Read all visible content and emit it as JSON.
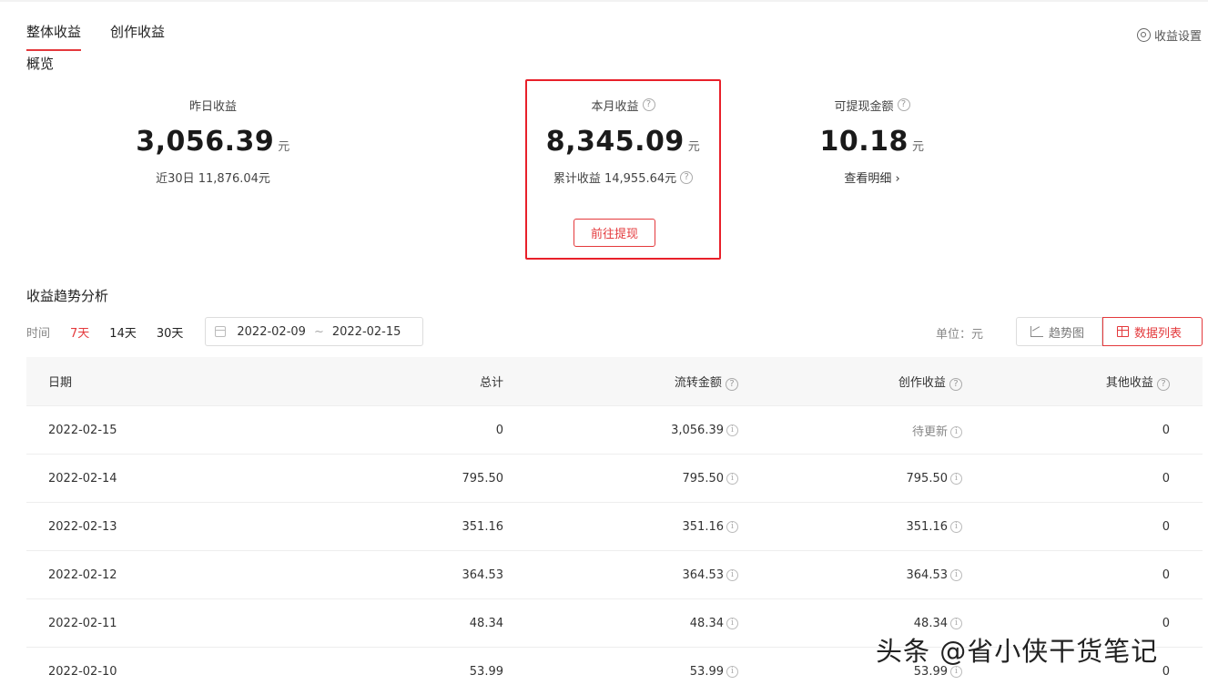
{
  "tabs": [
    {
      "label": "整体收益",
      "active": true
    },
    {
      "label": "创作收益",
      "active": false
    }
  ],
  "settings_label": "收益设置",
  "overview": {
    "title": "概览",
    "yesterday": {
      "label": "昨日收益",
      "value": "3,056.39",
      "unit": "元",
      "sub": "近30日 11,876.04元"
    },
    "month": {
      "label": "本月收益",
      "value": "8,345.09",
      "unit": "元",
      "sub": "累计收益 14,955.64元",
      "button": "前往提现"
    },
    "withdrawable": {
      "label": "可提现金额",
      "value": "10.18",
      "unit": "元",
      "link": "查看明细 ›"
    }
  },
  "trend": {
    "title": "收益趋势分析",
    "time_label": "时间",
    "ranges": [
      {
        "label": "7天",
        "active": true
      },
      {
        "label": "14天",
        "active": false
      },
      {
        "label": "30天",
        "active": false
      }
    ],
    "date_start": "2022-02-09",
    "date_sep": "~",
    "date_end": "2022-02-15",
    "unit_label": "单位：元",
    "view_chart": "趋势图",
    "view_table": "数据列表"
  },
  "table": {
    "headers": [
      "日期",
      "总计",
      "流转金额",
      "创作收益",
      "其他收益"
    ],
    "rows": [
      {
        "date": "2022-02-15",
        "total": "0",
        "flow": "3,056.39",
        "creation": "待更新",
        "other": "0"
      },
      {
        "date": "2022-02-14",
        "total": "795.50",
        "flow": "795.50",
        "creation": "795.50",
        "other": "0"
      },
      {
        "date": "2022-02-13",
        "total": "351.16",
        "flow": "351.16",
        "creation": "351.16",
        "other": "0"
      },
      {
        "date": "2022-02-12",
        "total": "364.53",
        "flow": "364.53",
        "creation": "364.53",
        "other": "0"
      },
      {
        "date": "2022-02-11",
        "total": "48.34",
        "flow": "48.34",
        "creation": "48.34",
        "other": "0"
      },
      {
        "date": "2022-02-10",
        "total": "53.99",
        "flow": "53.99",
        "creation": "53.99",
        "other": "0"
      }
    ]
  },
  "watermark": "头条 @省小侠干货笔记",
  "colors": {
    "accent": "#e4393c",
    "highlight_border": "#e8202a"
  }
}
